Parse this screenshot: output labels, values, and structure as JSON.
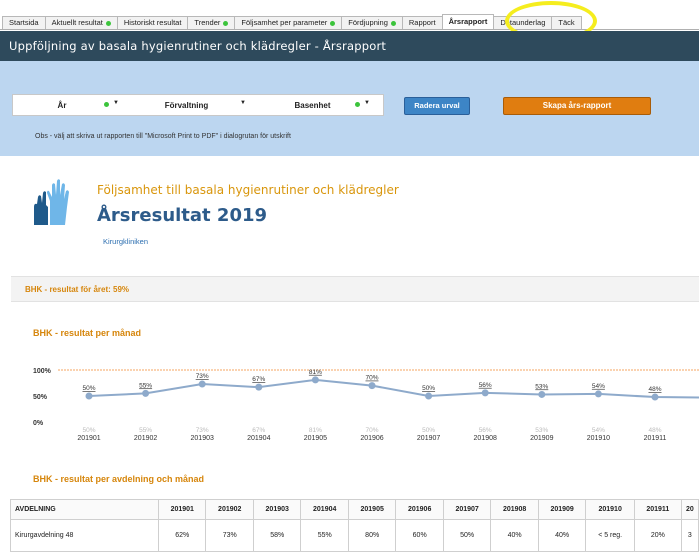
{
  "tabs": [
    {
      "label": "Startsida",
      "dot": false
    },
    {
      "label": "Aktuellt resultat",
      "dot": true
    },
    {
      "label": "Historiskt resultat",
      "dot": false
    },
    {
      "label": "Trender",
      "dot": true
    },
    {
      "label": "Följsamhet per parameter",
      "dot": true
    },
    {
      "label": "Fördjupning",
      "dot": true
    },
    {
      "label": "Rapport",
      "dot": false
    },
    {
      "label": "Årsrapport",
      "dot": false,
      "active": true
    },
    {
      "label": "Dataunderlag",
      "dot": false
    },
    {
      "label": "Täck",
      "dot": false
    }
  ],
  "header": {
    "title": "Uppföljning av basala hygienrutiner och klädregler - Årsrapport"
  },
  "filters": {
    "year": "År",
    "administration": "Förvaltning",
    "base_unit": "Basenhet"
  },
  "buttons": {
    "clear": "Radera urval",
    "create": "Skapa års-rapport"
  },
  "notice": "Obs - välj att skriva ut rapporten till \"Microsoft Print to PDF\" i dialogrutan för utskrift",
  "report": {
    "subtitle": "Följsamhet till basala hygienrutiner och klädregler",
    "title": "Årsresultat 2019",
    "clinic": "Kirurgkliniken"
  },
  "year_result": "BHK - resultat för året: 59%",
  "monthly_title": "BHK - resultat per månad",
  "dept_title": "BHK - resultat per avdelning och månad",
  "chart_data": {
    "type": "line",
    "x": [
      "201901",
      "201902",
      "201903",
      "201904",
      "201905",
      "201906",
      "201907",
      "201908",
      "201909",
      "201910",
      "201911"
    ],
    "series": [
      {
        "values": [
          50,
          55,
          73,
          67,
          81,
          70,
          50,
          56,
          53,
          54,
          48
        ]
      }
    ],
    "data_labels": [
      "50%",
      "55%",
      "73%",
      "67%",
      "81%",
      "70%",
      "50%",
      "56%",
      "53%",
      "54%",
      "48%"
    ],
    "y_ticks": [
      "100%",
      "50%",
      "0%"
    ],
    "ylim": [
      0,
      100
    ],
    "target_line": 100,
    "colors": {
      "line": "#8eaacb",
      "marker": "#8eaacb",
      "target": "#f4a460"
    }
  },
  "table": {
    "headers": [
      "AVDELNING",
      "201901",
      "201902",
      "201903",
      "201904",
      "201905",
      "201906",
      "201907",
      "201908",
      "201909",
      "201910",
      "201911",
      "20"
    ],
    "rows": [
      [
        "Kirurgavdelning 48",
        "62%",
        "73%",
        "58%",
        "55%",
        "80%",
        "60%",
        "50%",
        "40%",
        "40%",
        "< 5 reg.",
        "20%",
        "3"
      ]
    ]
  }
}
